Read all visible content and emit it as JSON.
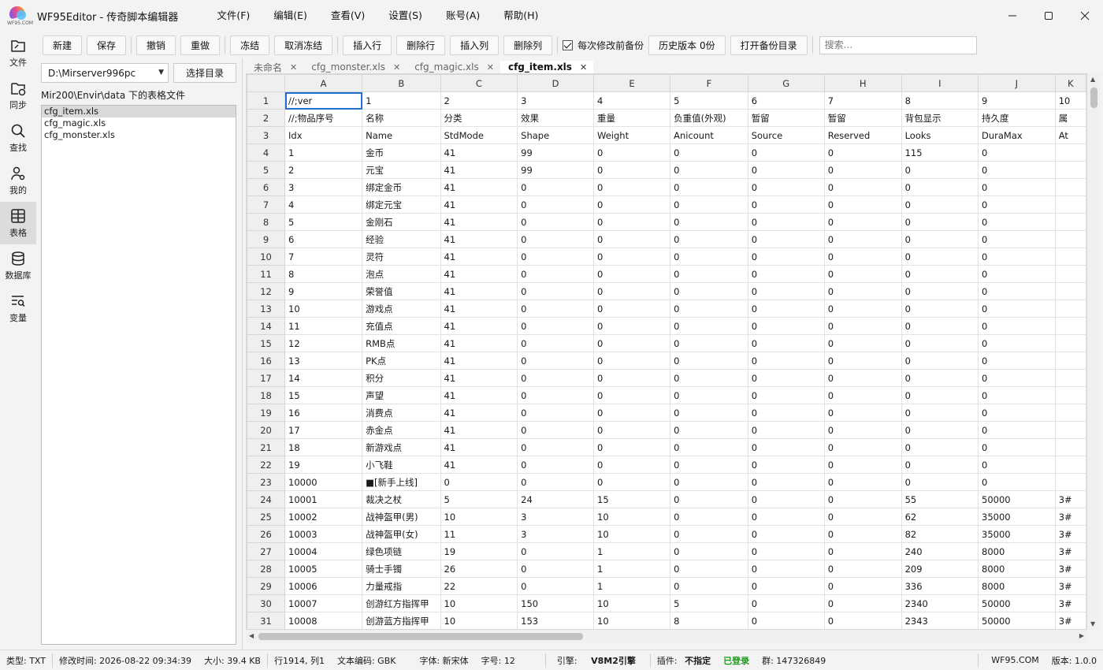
{
  "app": {
    "logo_text": "WF95.COM",
    "title": "WF95Editor - 传奇脚本编辑器"
  },
  "menu": [
    "文件(F)",
    "编辑(E)",
    "查看(V)",
    "设置(S)",
    "账号(A)",
    "帮助(H)"
  ],
  "nav": [
    {
      "label": "文件",
      "icon": "folder-icon"
    },
    {
      "label": "同步",
      "icon": "sync-icon"
    },
    {
      "label": "查找",
      "icon": "search-icon"
    },
    {
      "label": "我的",
      "icon": "user-icon"
    },
    {
      "label": "表格",
      "icon": "table-icon"
    },
    {
      "label": "数据库",
      "icon": "database-icon"
    },
    {
      "label": "变量",
      "icon": "variable-icon"
    }
  ],
  "toolbar": {
    "new": "新建",
    "save": "保存",
    "undo": "撤销",
    "redo": "重做",
    "freeze": "冻结",
    "unfreeze": "取消冻结",
    "insert_row": "插入行",
    "delete_row": "删除行",
    "insert_col": "插入列",
    "delete_col": "删除列",
    "backup_check": "每次修改前备份",
    "history": "历史版本 0份",
    "open_backup": "打开备份目录",
    "search_placeholder": "搜索..."
  },
  "filepanel": {
    "dir_value": "D:\\Mirserver996pc",
    "choose_dir": "选择目录",
    "caption": "Mir200\\Envir\\data 下的表格文件",
    "files": [
      "cfg_item.xls",
      "cfg_magic.xls",
      "cfg_monster.xls"
    ]
  },
  "tabs": [
    "未命名",
    "cfg_monster.xls",
    "cfg_magic.xls",
    "cfg_item.xls"
  ],
  "grid": {
    "columns": [
      "A",
      "B",
      "C",
      "D",
      "E",
      "F",
      "G",
      "H",
      "I",
      "J",
      "K"
    ],
    "rows": [
      [
        "//;ver",
        "1",
        "2",
        "3",
        "4",
        "5",
        "6",
        "7",
        "8",
        "9",
        "10"
      ],
      [
        "//;物品序号",
        "名称",
        "分类",
        "效果",
        "重量",
        "负重值(外观)",
        "暂留",
        "暂留",
        "背包显示",
        "持久度",
        "属"
      ],
      [
        "Idx",
        "Name",
        "StdMode",
        "Shape",
        "Weight",
        "Anicount",
        "Source",
        "Reserved",
        "Looks",
        "DuraMax",
        "At"
      ],
      [
        "1",
        "金币",
        "41",
        "99",
        "0",
        "0",
        "0",
        "0",
        "115",
        "0",
        ""
      ],
      [
        "2",
        "元宝",
        "41",
        "99",
        "0",
        "0",
        "0",
        "0",
        "0",
        "0",
        ""
      ],
      [
        "3",
        "绑定金币",
        "41",
        "0",
        "0",
        "0",
        "0",
        "0",
        "0",
        "0",
        ""
      ],
      [
        "4",
        "绑定元宝",
        "41",
        "0",
        "0",
        "0",
        "0",
        "0",
        "0",
        "0",
        ""
      ],
      [
        "5",
        "金刚石",
        "41",
        "0",
        "0",
        "0",
        "0",
        "0",
        "0",
        "0",
        ""
      ],
      [
        "6",
        "经验",
        "41",
        "0",
        "0",
        "0",
        "0",
        "0",
        "0",
        "0",
        ""
      ],
      [
        "7",
        "灵符",
        "41",
        "0",
        "0",
        "0",
        "0",
        "0",
        "0",
        "0",
        ""
      ],
      [
        "8",
        "泡点",
        "41",
        "0",
        "0",
        "0",
        "0",
        "0",
        "0",
        "0",
        ""
      ],
      [
        "9",
        "荣誉值",
        "41",
        "0",
        "0",
        "0",
        "0",
        "0",
        "0",
        "0",
        ""
      ],
      [
        "10",
        "游戏点",
        "41",
        "0",
        "0",
        "0",
        "0",
        "0",
        "0",
        "0",
        ""
      ],
      [
        "11",
        "充值点",
        "41",
        "0",
        "0",
        "0",
        "0",
        "0",
        "0",
        "0",
        ""
      ],
      [
        "12",
        "RMB点",
        "41",
        "0",
        "0",
        "0",
        "0",
        "0",
        "0",
        "0",
        ""
      ],
      [
        "13",
        "PK点",
        "41",
        "0",
        "0",
        "0",
        "0",
        "0",
        "0",
        "0",
        ""
      ],
      [
        "14",
        "积分",
        "41",
        "0",
        "0",
        "0",
        "0",
        "0",
        "0",
        "0",
        ""
      ],
      [
        "15",
        "声望",
        "41",
        "0",
        "0",
        "0",
        "0",
        "0",
        "0",
        "0",
        ""
      ],
      [
        "16",
        "消费点",
        "41",
        "0",
        "0",
        "0",
        "0",
        "0",
        "0",
        "0",
        ""
      ],
      [
        "17",
        "赤金点",
        "41",
        "0",
        "0",
        "0",
        "0",
        "0",
        "0",
        "0",
        ""
      ],
      [
        "18",
        "新游戏点",
        "41",
        "0",
        "0",
        "0",
        "0",
        "0",
        "0",
        "0",
        ""
      ],
      [
        "19",
        "小飞鞋",
        "41",
        "0",
        "0",
        "0",
        "0",
        "0",
        "0",
        "0",
        ""
      ],
      [
        "10000",
        "■[新手上线]",
        "0",
        "0",
        "0",
        "0",
        "0",
        "0",
        "0",
        "0",
        ""
      ],
      [
        "10001",
        "裁决之杖",
        "5",
        "24",
        "15",
        "0",
        "0",
        "0",
        "55",
        "50000",
        "3#"
      ],
      [
        "10002",
        "战神盔甲(男)",
        "10",
        "3",
        "10",
        "0",
        "0",
        "0",
        "62",
        "35000",
        "3#"
      ],
      [
        "10003",
        "战神盔甲(女)",
        "11",
        "3",
        "10",
        "0",
        "0",
        "0",
        "82",
        "35000",
        "3#"
      ],
      [
        "10004",
        "绿色项链",
        "19",
        "0",
        "1",
        "0",
        "0",
        "0",
        "240",
        "8000",
        "3#"
      ],
      [
        "10005",
        "骑士手镯",
        "26",
        "0",
        "1",
        "0",
        "0",
        "0",
        "209",
        "8000",
        "3#"
      ],
      [
        "10006",
        "力量戒指",
        "22",
        "0",
        "1",
        "0",
        "0",
        "0",
        "336",
        "8000",
        "3#"
      ],
      [
        "10007",
        "创游红方指挥甲",
        "10",
        "150",
        "10",
        "5",
        "0",
        "0",
        "2340",
        "50000",
        "3#"
      ],
      [
        "10008",
        "创游蓝方指挥甲",
        "10",
        "153",
        "10",
        "8",
        "0",
        "0",
        "2343",
        "50000",
        "3#"
      ]
    ]
  },
  "status": {
    "type": "类型: TXT",
    "modified": "修改时间: 2026-08-22 09:34:39",
    "size": "大小: 39.4 KB",
    "position": "行1914, 列1",
    "encoding": "文本编码: GBK",
    "font": "字体: 新宋体",
    "font_size": "字号: 12",
    "engine_label": "引擎:",
    "engine_value": "V8M2引擎",
    "plugin_label": "插件:",
    "plugin_value": "不指定",
    "login": "已登录",
    "group": "群: 147326849",
    "site": "WF95.COM",
    "version": "版本: 1.0.0"
  }
}
